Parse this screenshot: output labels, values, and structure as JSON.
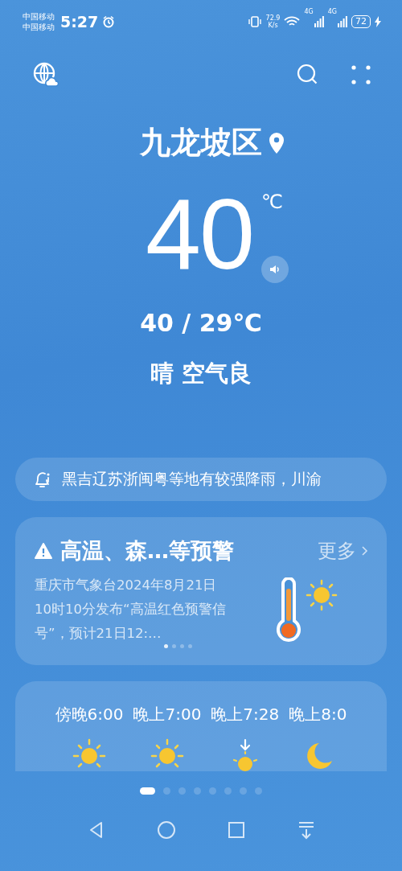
{
  "status_bar": {
    "carriers": [
      "中国移动",
      "中国移动"
    ],
    "time": "5:27",
    "speed": "72.9",
    "speed_unit": "K/s",
    "network_1": "4G",
    "network_2": "4G",
    "battery": "72",
    "charging": true
  },
  "location": {
    "city": "九龙坡区"
  },
  "current": {
    "temperature": "40",
    "unit": "℃",
    "range": "40 / 29℃",
    "condition": "晴 空气良"
  },
  "news": {
    "text": "黑吉辽苏浙闽粤等地有较强降雨，川渝"
  },
  "warning": {
    "title": "高温、森…等预警",
    "more": "更多",
    "body": "重庆市气象台2024年8月21日10时10分发布“高温红色预警信号”，预计21日12:…",
    "pages": [
      {
        "selected": true
      },
      {
        "selected": false
      },
      {
        "selected": false
      },
      {
        "selected": false
      }
    ]
  },
  "hourly": [
    {
      "time": "傍晚6:00",
      "kind": "sun"
    },
    {
      "time": "晚上7:00",
      "kind": "sun"
    },
    {
      "time": "晚上7:28",
      "kind": "sunset"
    },
    {
      "time": "晚上8:0",
      "kind": "moon"
    }
  ],
  "pages": [
    {
      "selected": true
    },
    {
      "selected": false
    },
    {
      "selected": false
    },
    {
      "selected": false
    },
    {
      "selected": false
    },
    {
      "selected": false
    },
    {
      "selected": false
    },
    {
      "selected": false
    }
  ]
}
